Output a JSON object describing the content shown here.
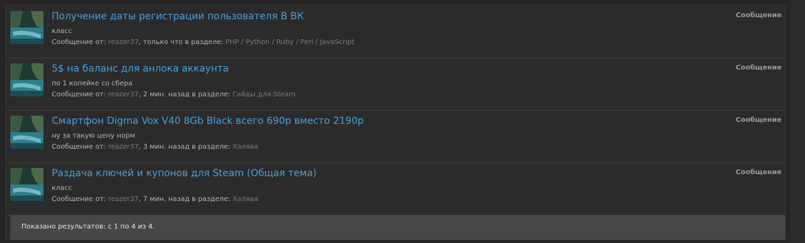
{
  "results": [
    {
      "title": "Получение даты регистрации пользователя В ВК",
      "snippet": "класс",
      "meta_prefix": "Сообщение от: ",
      "author": "reazer37",
      "time": ", только что в разделе: ",
      "section": "PHP / Python / Ruby / Perl / JavaScript",
      "type": "Сообщение"
    },
    {
      "title": "5$ на баланс для анлока аккаунта",
      "snippet": "по 1 копейке со сбера",
      "meta_prefix": "Сообщение от: ",
      "author": "reazer37",
      "time": ", 2 мин. назад в разделе: ",
      "section": "Гайды для Steam",
      "type": "Сообщение"
    },
    {
      "title": "Смартфон Digma Vox V40 8Gb Black всего 690р вместо 2190р",
      "snippet": "ну за такую цену норм",
      "meta_prefix": "Сообщение от: ",
      "author": "reazer37",
      "time": ", 3 мин. назад в разделе: ",
      "section": "Халява",
      "type": "Сообщение"
    },
    {
      "title": "Раздача ключей и купонов для Steam (Общая тема)",
      "snippet": "класс",
      "meta_prefix": "Сообщение от: ",
      "author": "reazer37",
      "time": ", 7 мин. назад в разделе: ",
      "section": "Халява",
      "type": "Сообщение"
    }
  ],
  "footer": {
    "summary": "Показано результатов: с 1 по 4 из 4."
  },
  "colors": {
    "link": "#4a9fd9",
    "muted_link": "#7d7d7d",
    "text": "#b5b5b5"
  }
}
